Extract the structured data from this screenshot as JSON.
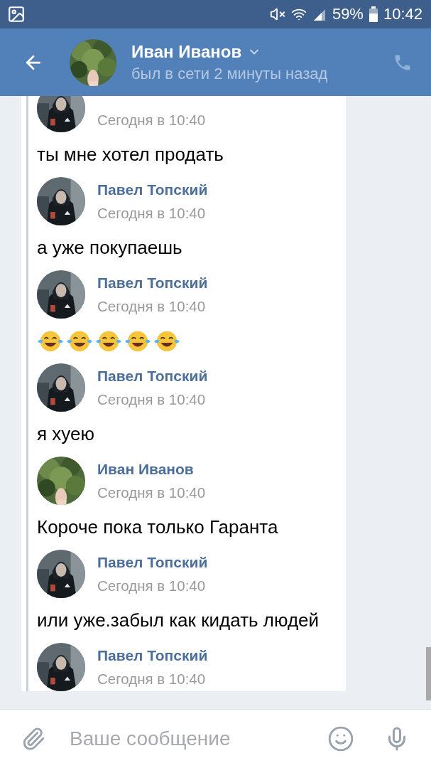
{
  "status_bar": {
    "battery": "59%",
    "time": "10:42"
  },
  "header": {
    "name": "Иван Иванов",
    "status": "был в сети 2 минуты назад"
  },
  "messages": [
    {
      "kind": "outgoing",
      "time": "Сегодня в 10:40",
      "body": {
        "kind": "text",
        "text": "ты мне хотел продать"
      }
    },
    {
      "kind": "outgoing",
      "author": "Павел Топский",
      "time": "Сегодня в 10:40",
      "body": {
        "kind": "text",
        "text": "а уже покупаешь"
      }
    },
    {
      "kind": "outgoing",
      "author": "Павел Топский",
      "time": "Сегодня в 10:40",
      "body": {
        "kind": "emoji",
        "emojis": [
          {
            "kind": "laughing"
          },
          {
            "kind": "laughing"
          },
          {
            "kind": "laughing"
          },
          {
            "kind": "laughing"
          },
          {
            "kind": "laughing"
          }
        ]
      }
    },
    {
      "kind": "outgoing",
      "author": "Павел Топский",
      "time": "Сегодня в 10:40",
      "body": {
        "kind": "text",
        "text": "я хуею"
      }
    },
    {
      "kind": "incoming",
      "author": "Иван Иванов",
      "time": "Сегодня в 10:40",
      "body": {
        "kind": "text",
        "text": "Короче пока только Гаранта"
      }
    },
    {
      "kind": "outgoing",
      "author": "Павел Топский",
      "time": "Сегодня в 10:40",
      "body": {
        "kind": "text",
        "text": "или уже.забыл как кидать людей"
      }
    },
    {
      "kind": "outgoing",
      "author": "Павел Топский",
      "time": "Сегодня в 10:40"
    }
  ],
  "composer": {
    "placeholder": "Ваше сообщение"
  }
}
